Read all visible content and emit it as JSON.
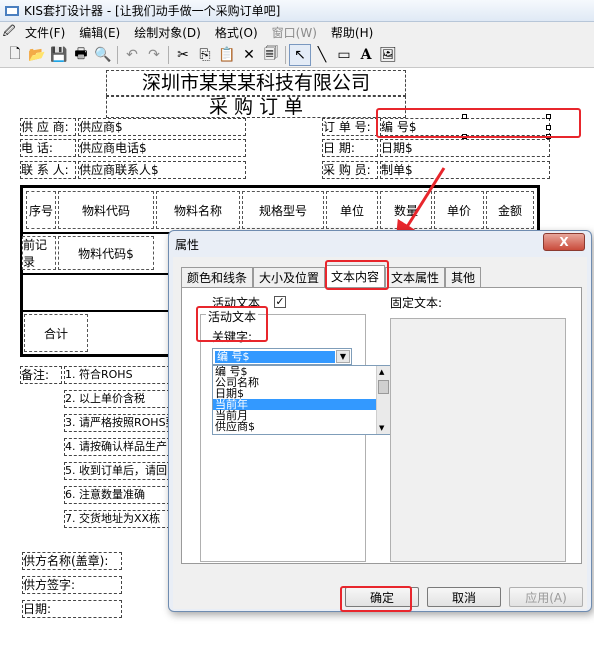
{
  "window": {
    "title": "KIS套打设计器 - [让我们动手做一个采购订单吧]"
  },
  "menu": [
    {
      "label": "文件(F)",
      "enabled": true
    },
    {
      "label": "编辑(E)",
      "enabled": true
    },
    {
      "label": "绘制对象(D)",
      "enabled": true
    },
    {
      "label": "格式(O)",
      "enabled": true
    },
    {
      "label": "窗口(W)",
      "enabled": false
    },
    {
      "label": "帮助(H)",
      "enabled": true
    }
  ],
  "toolbar": {
    "icons": [
      "new-file-icon",
      "open-folder-icon",
      "save-icon",
      "print-icon",
      "print-preview-icon",
      "undo-icon",
      "redo-icon",
      "cut-icon",
      "copy-icon",
      "paste-icon",
      "delete-icon",
      "clipboard-icon",
      "pointer-icon",
      "line-icon",
      "rectangle-icon",
      "text-icon",
      "image-icon"
    ],
    "glyphs": [
      "🗋",
      "📂",
      "💾",
      "🖶",
      "🔍",
      "↶",
      "↷",
      "✂",
      "⎘",
      "📋",
      "✕",
      "🗐",
      "↖",
      "╲",
      "▭",
      "A",
      "🖼"
    ]
  },
  "document": {
    "company": "深圳市某某某科技有限公司",
    "doc_title": "采 购 订 单",
    "fields_left": [
      {
        "label": "供 应 商:",
        "value": "供应商$"
      },
      {
        "label": "电     话:",
        "value": "供应商电话$"
      },
      {
        "label": "联 系 人:",
        "value": "供应商联系人$"
      }
    ],
    "fields_right": [
      {
        "label": "订 单 号:",
        "value": "编        号$"
      },
      {
        "label": "日     期:",
        "value": "日期$"
      },
      {
        "label": "采 购 员:",
        "value": "制单$"
      }
    ],
    "table_headers": [
      "序号",
      "物料代码",
      "物料名称",
      "规格型号",
      "单位",
      "数量",
      "单价",
      "金额"
    ],
    "row_labels": [
      "前记录",
      "物料代码$"
    ],
    "total_label": "合计",
    "remarks_label": "备注:",
    "remarks": [
      "1. 符合ROHS",
      "2. 以上单价含税",
      "3. 请严格按照ROHS要",
      "4. 请按确认样品生产",
      "5. 收到订单后，请回",
      "6. 注意数量准确",
      "7. 交货地址为XX栋"
    ],
    "footer": [
      "供方名称(盖章):",
      "供方签字:",
      "日期:"
    ]
  },
  "dialog": {
    "title": "属性",
    "close_label": "X",
    "tabs": [
      {
        "label": "颜色和线条",
        "selected": false
      },
      {
        "label": "大小及位置",
        "selected": false
      },
      {
        "label": "文本内容",
        "selected": true
      },
      {
        "label": "文本属性",
        "selected": false
      },
      {
        "label": "其他",
        "selected": false
      }
    ],
    "active_text_label": "活动文本",
    "active_text_checked": true,
    "checkmark": "✓",
    "group_title": "活动文本",
    "keyword_label": "关键字:",
    "combo_value": "编        号$",
    "combo_arrow": "▼",
    "keyword_options": [
      "编        号$",
      "公司名称",
      "日期$",
      "当前年",
      "当前月",
      "供应商$"
    ],
    "highlighted_option": 3,
    "fixed_text_label": "固定文本:",
    "buttons": {
      "ok": "确定",
      "cancel": "取消",
      "apply": "应用(A)"
    }
  },
  "colors": {
    "highlight_red": "#e8262c",
    "selection_blue": "#3399ff",
    "dialog_frame": "#6f8cb0"
  }
}
